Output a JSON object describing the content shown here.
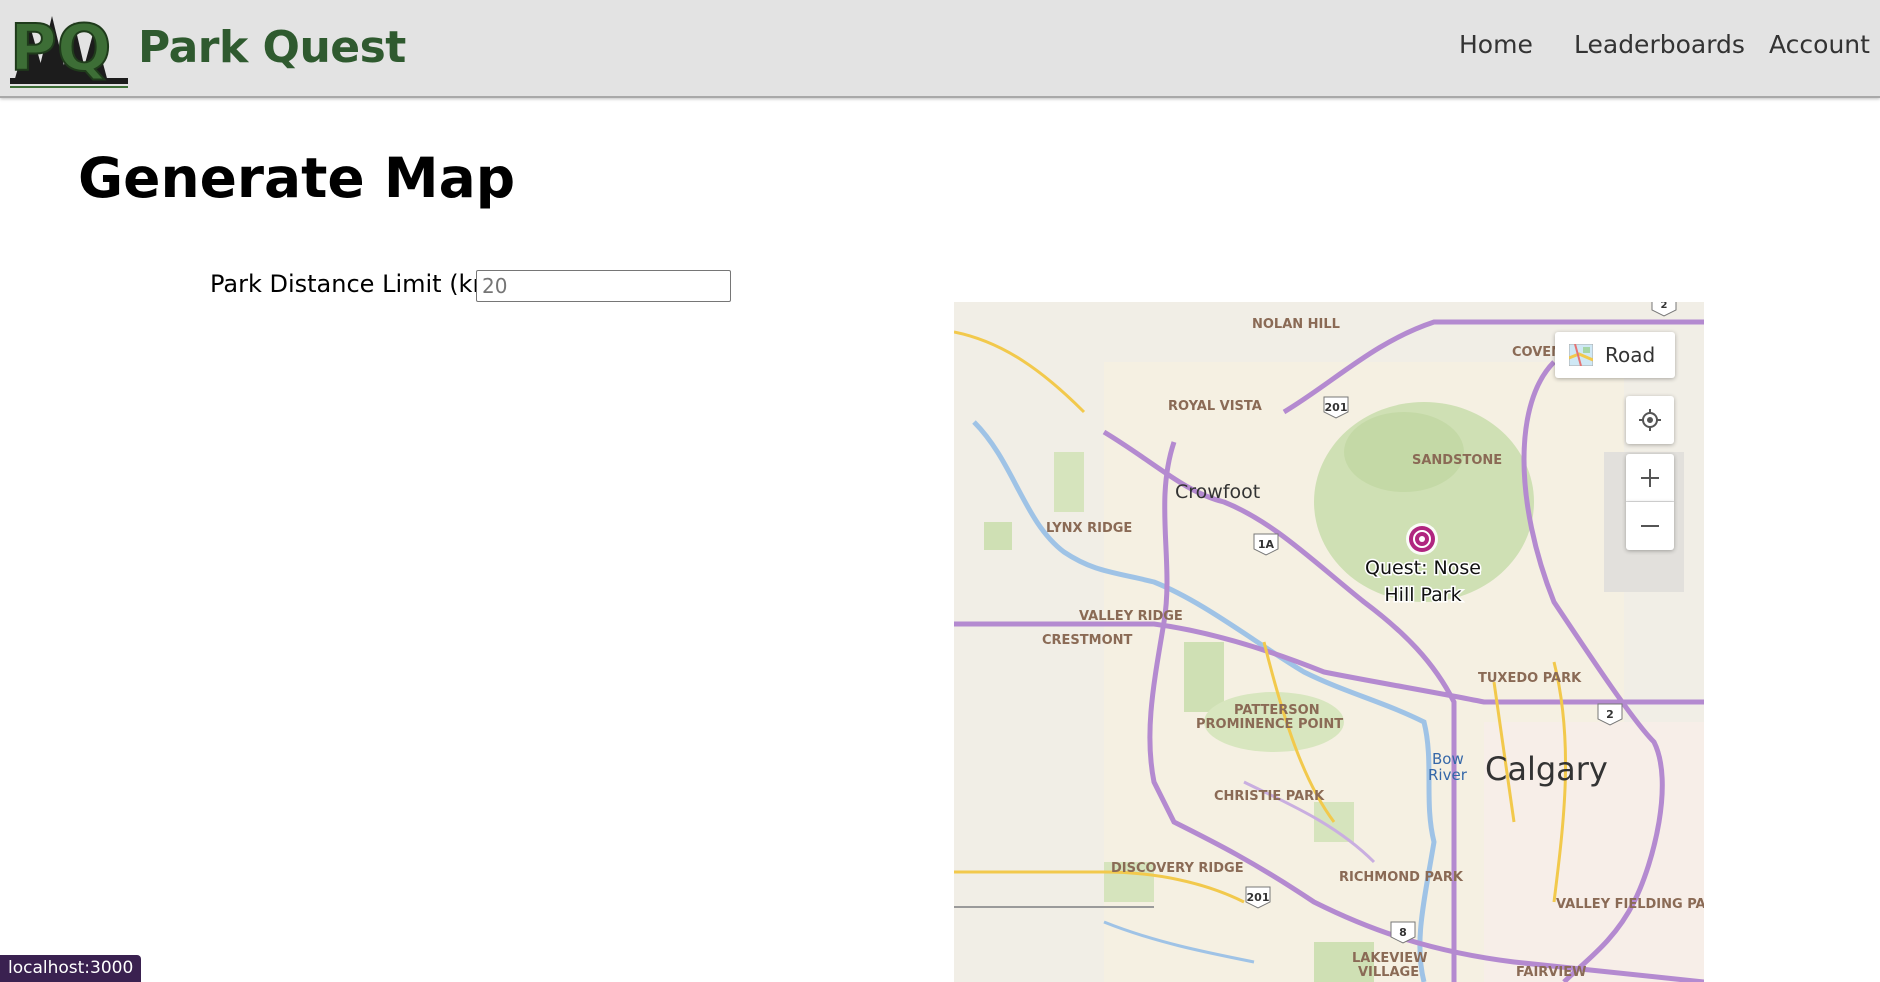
{
  "brand": {
    "name": "Park Quest",
    "logo_letters": "PQ",
    "color": "#2f5a2f"
  },
  "nav": {
    "items": [
      {
        "label": "Home"
      },
      {
        "label": "Leaderboards"
      },
      {
        "label": "Account"
      }
    ]
  },
  "page": {
    "title": "Generate Map"
  },
  "form": {
    "distance_label": "Park Distance Limit (km):",
    "distance_placeholder": "20",
    "distance_value": ""
  },
  "map": {
    "style_label": "Road",
    "pin_label_line1": "Quest: Nose",
    "pin_label_line2": "Hill Park",
    "pin_color": "#b0257f",
    "city_labels": {
      "calgary": "Calgary",
      "crowfoot": "Crowfoot",
      "bow_river_1": "Bow",
      "bow_river_2": "River"
    },
    "neighborhoods": {
      "nolan_hill": "NOLAN HILL",
      "coven": "COVEN",
      "royal_vista": "ROYAL VISTA",
      "sandstone": "SANDSTONE",
      "lynx_ridge": "LYNX RIDGE",
      "valley_ridge": "VALLEY RIDGE",
      "crestmont": "CRESTMONT",
      "tuxedo_park": "TUXEDO PARK",
      "patterson": "PATTERSON",
      "prominence_point": "PROMINENCE POINT",
      "christie_park": "CHRISTIE PARK",
      "discovery_ridge": "DISCOVERY RIDGE",
      "richmond_park": "RICHMOND PARK",
      "valley_fielding_park": "VALLEY FIELDING PARK",
      "lakeview": "LAKEVIEW",
      "village": "VILLAGE",
      "fairview": "FAIRVIEW"
    },
    "highway_shields": {
      "h201a": "201",
      "h1a": "1A",
      "h2": "2",
      "h201b": "201",
      "h8": "8",
      "h2top": "2"
    }
  },
  "status_bar": {
    "url": "localhost:3000"
  }
}
